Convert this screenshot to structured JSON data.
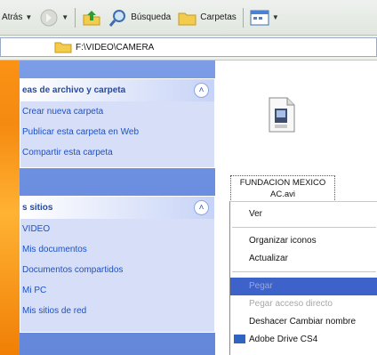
{
  "toolbar": {
    "back_label": "Atrás",
    "search_label": "Búsqueda",
    "folders_label": "Carpetas"
  },
  "address": {
    "path": "F:\\VIDEO\\CAMERA"
  },
  "tasks_box": {
    "title": "eas de archivo y carpeta",
    "items": [
      "Crear nueva carpeta",
      "Publicar esta carpeta en Web",
      "Compartir esta carpeta"
    ]
  },
  "places_box": {
    "title": "s sitios",
    "items": [
      "VIDEO",
      "Mis documentos",
      "Documentos compartidos",
      "Mi PC",
      "Mis sitios de red"
    ]
  },
  "file": {
    "name_line1": "FUNDACION MEXICO",
    "name_line2": "AC.avi"
  },
  "context_menu": {
    "view": "Ver",
    "arrange_icons": "Organizar iconos",
    "refresh": "Actualizar",
    "paste": "Pegar",
    "paste_shortcut": "Pegar acceso directo",
    "undo": "Deshacer Cambiar nombre",
    "adobe": "Adobe Drive CS4"
  },
  "colors": {
    "accent": "#3d62c9",
    "link": "#1c50c8",
    "pane": "#6d8fe0",
    "desktop": "#f58a10"
  }
}
